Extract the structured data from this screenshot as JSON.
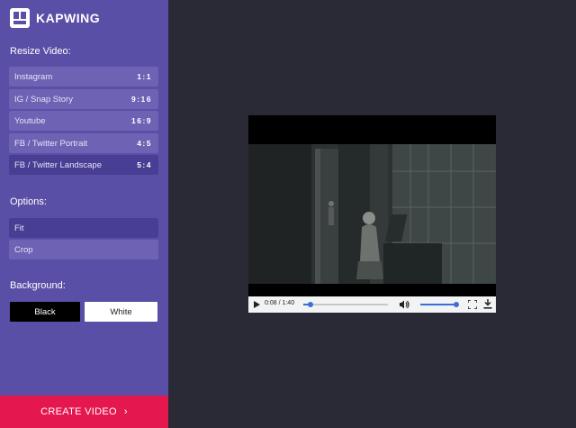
{
  "brand": {
    "name": "KAPWING"
  },
  "resize": {
    "title": "Resize Video:",
    "options": [
      {
        "label": "Instagram",
        "ratio": "1:1",
        "selected": false
      },
      {
        "label": "IG / Snap Story",
        "ratio": "9:16",
        "selected": false
      },
      {
        "label": "Youtube",
        "ratio": "16:9",
        "selected": false
      },
      {
        "label": "FB / Twitter Portrait",
        "ratio": "4:5",
        "selected": false
      },
      {
        "label": "FB / Twitter Landscape",
        "ratio": "5:4",
        "selected": true
      }
    ]
  },
  "options": {
    "title": "Options:",
    "items": [
      {
        "label": "Fit",
        "selected": true
      },
      {
        "label": "Crop",
        "selected": false
      }
    ]
  },
  "background": {
    "title": "Background:",
    "black_label": "Black",
    "white_label": "White"
  },
  "create": {
    "label": "CREATE VIDEO",
    "chevron": "›"
  },
  "player": {
    "time": "0:08 / 1:40",
    "progress_fraction": 0.08,
    "volume_fraction": 1.0
  },
  "colors": {
    "sidebar": "#5a4fa6",
    "option": "#6e62b5",
    "option_selected": "#483e93",
    "cta": "#e5174f",
    "workspace": "#292a36",
    "accent": "#3b6fd6"
  },
  "icons": [
    "kapwing-logo-icon",
    "play-icon",
    "volume-icon",
    "fullscreen-icon",
    "download-icon",
    "chevron-right-icon"
  ]
}
